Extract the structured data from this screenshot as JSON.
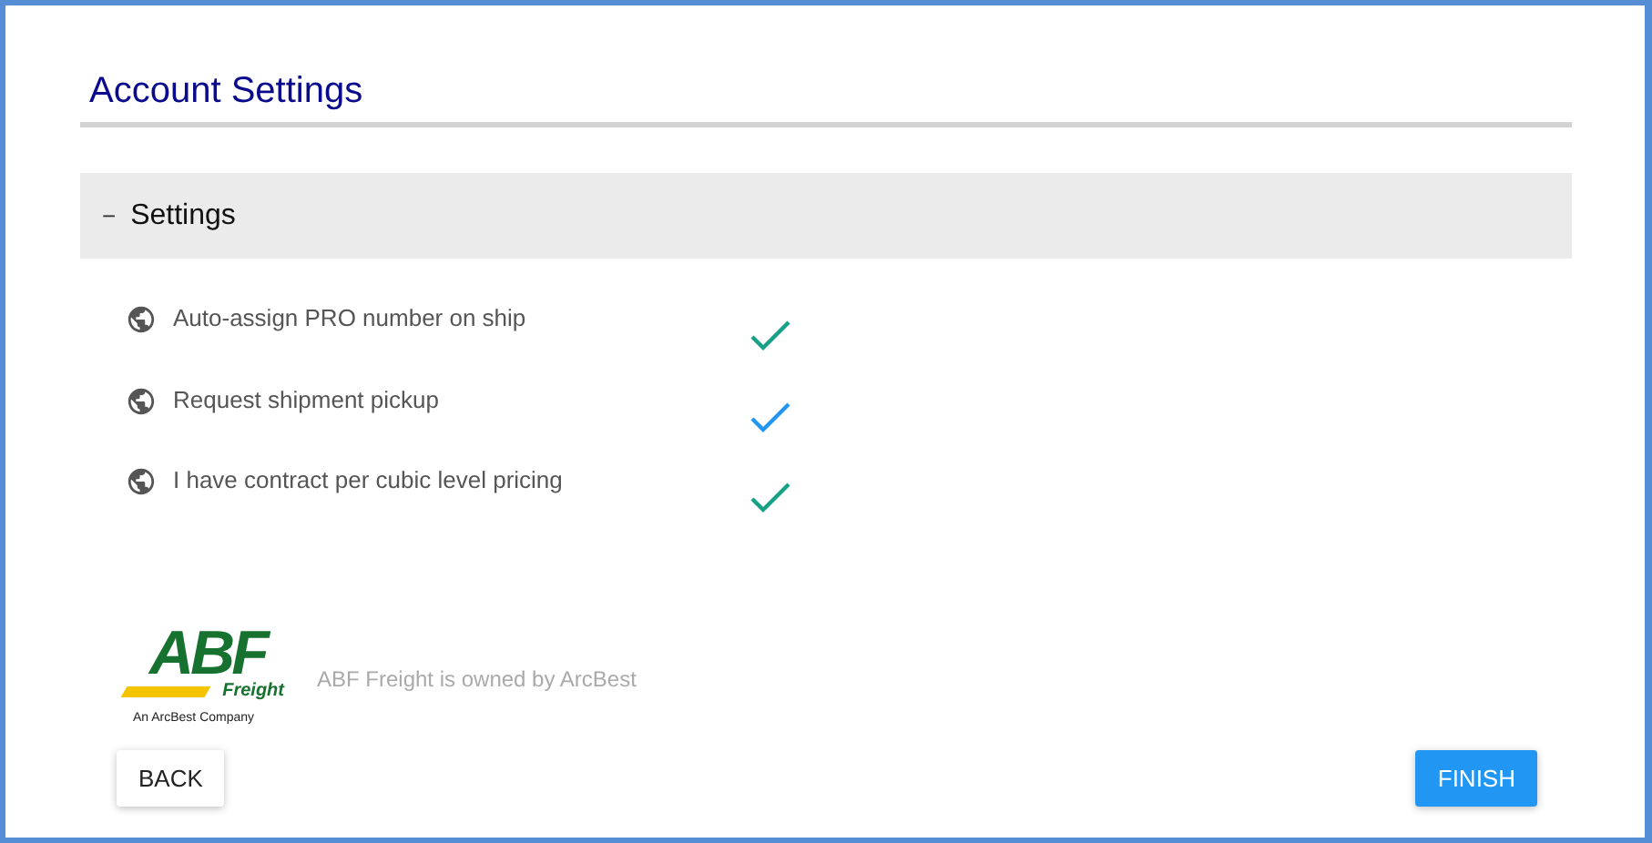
{
  "title": "Account Settings",
  "section": {
    "toggle": "−",
    "label": "Settings",
    "expanded": true,
    "items": [
      {
        "label": "Auto-assign PRO number on ship",
        "checked": true,
        "color": "#16a085"
      },
      {
        "label": "Request shipment pickup",
        "checked": true,
        "color": "#2196f3"
      },
      {
        "label": "I have contract per cubic level pricing",
        "checked": true,
        "color": "#16a085"
      }
    ]
  },
  "logo": {
    "mark": "ABF",
    "sub": "Freight",
    "tagline": "An ArcBest Company"
  },
  "ownership": "ABF Freight is owned by ArcBest",
  "buttons": [
    {
      "label": "BACK",
      "kind": "secondary"
    },
    {
      "label": "FINISH",
      "kind": "primary"
    }
  ]
}
